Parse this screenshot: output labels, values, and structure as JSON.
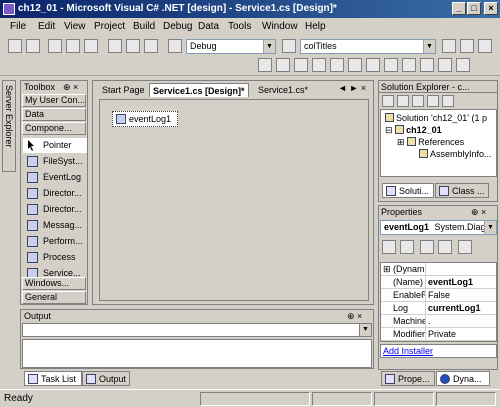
{
  "window": {
    "title": "ch12_01 - Microsoft Visual C# .NET [design] - Service1.cs [Design]*",
    "min": "_",
    "max": "□",
    "close": "×"
  },
  "menu": [
    "File",
    "Edit",
    "View",
    "Project",
    "Build",
    "Debug",
    "Data",
    "Tools",
    "Window",
    "Help"
  ],
  "toolbar": {
    "config_value": "Debug",
    "find_value": "colTitles"
  },
  "server_explorer_tab": "Server Explorer",
  "toolbox": {
    "title": "Toolbox",
    "pin": "⊕ ×",
    "categories_top": [
      "My User Con...",
      "Data",
      "Compone..."
    ],
    "items": [
      "Pointer",
      "FileSyst...",
      "EventLog",
      "Director...",
      "Director...",
      "Messag...",
      "Perform...",
      "Process",
      "Service..."
    ],
    "categories_bottom": [
      "Windows...",
      "General"
    ]
  },
  "document": {
    "tabs": [
      "Start Page",
      "Service1.cs [Design]*",
      "Service1.cs*"
    ],
    "nav": "◄ ► ×",
    "component_label": "eventLog1"
  },
  "output": {
    "title": "Output",
    "pin": "⊕ ×"
  },
  "bottom_tabs": [
    "Task List",
    "Output"
  ],
  "solution_explorer": {
    "title": "Solution Explorer - c...",
    "pin": "⊕ ×",
    "tree": [
      "Solution 'ch12_01' (1 p",
      "ch12_01",
      "References",
      "AssemblyInfo..."
    ],
    "tabs": [
      "Soluti...",
      "Class ..."
    ]
  },
  "properties": {
    "title": "Properties",
    "pin": "⊕ ×",
    "object": "eventLog1",
    "object_type": "System.Diag",
    "rows": [
      {
        "name": "(Dynami",
        "value": ""
      },
      {
        "name": "(Name)",
        "value": "eventLog1"
      },
      {
        "name": "EnableR",
        "value": "False"
      },
      {
        "name": "Log",
        "value": "currentLog1"
      },
      {
        "name": "Machine",
        "value": "."
      },
      {
        "name": "Modifier",
        "value": "Private"
      }
    ],
    "add_installer": "Add Installer",
    "tabs": [
      "Prope...",
      "Dyna..."
    ]
  },
  "status": {
    "text": "Ready"
  }
}
